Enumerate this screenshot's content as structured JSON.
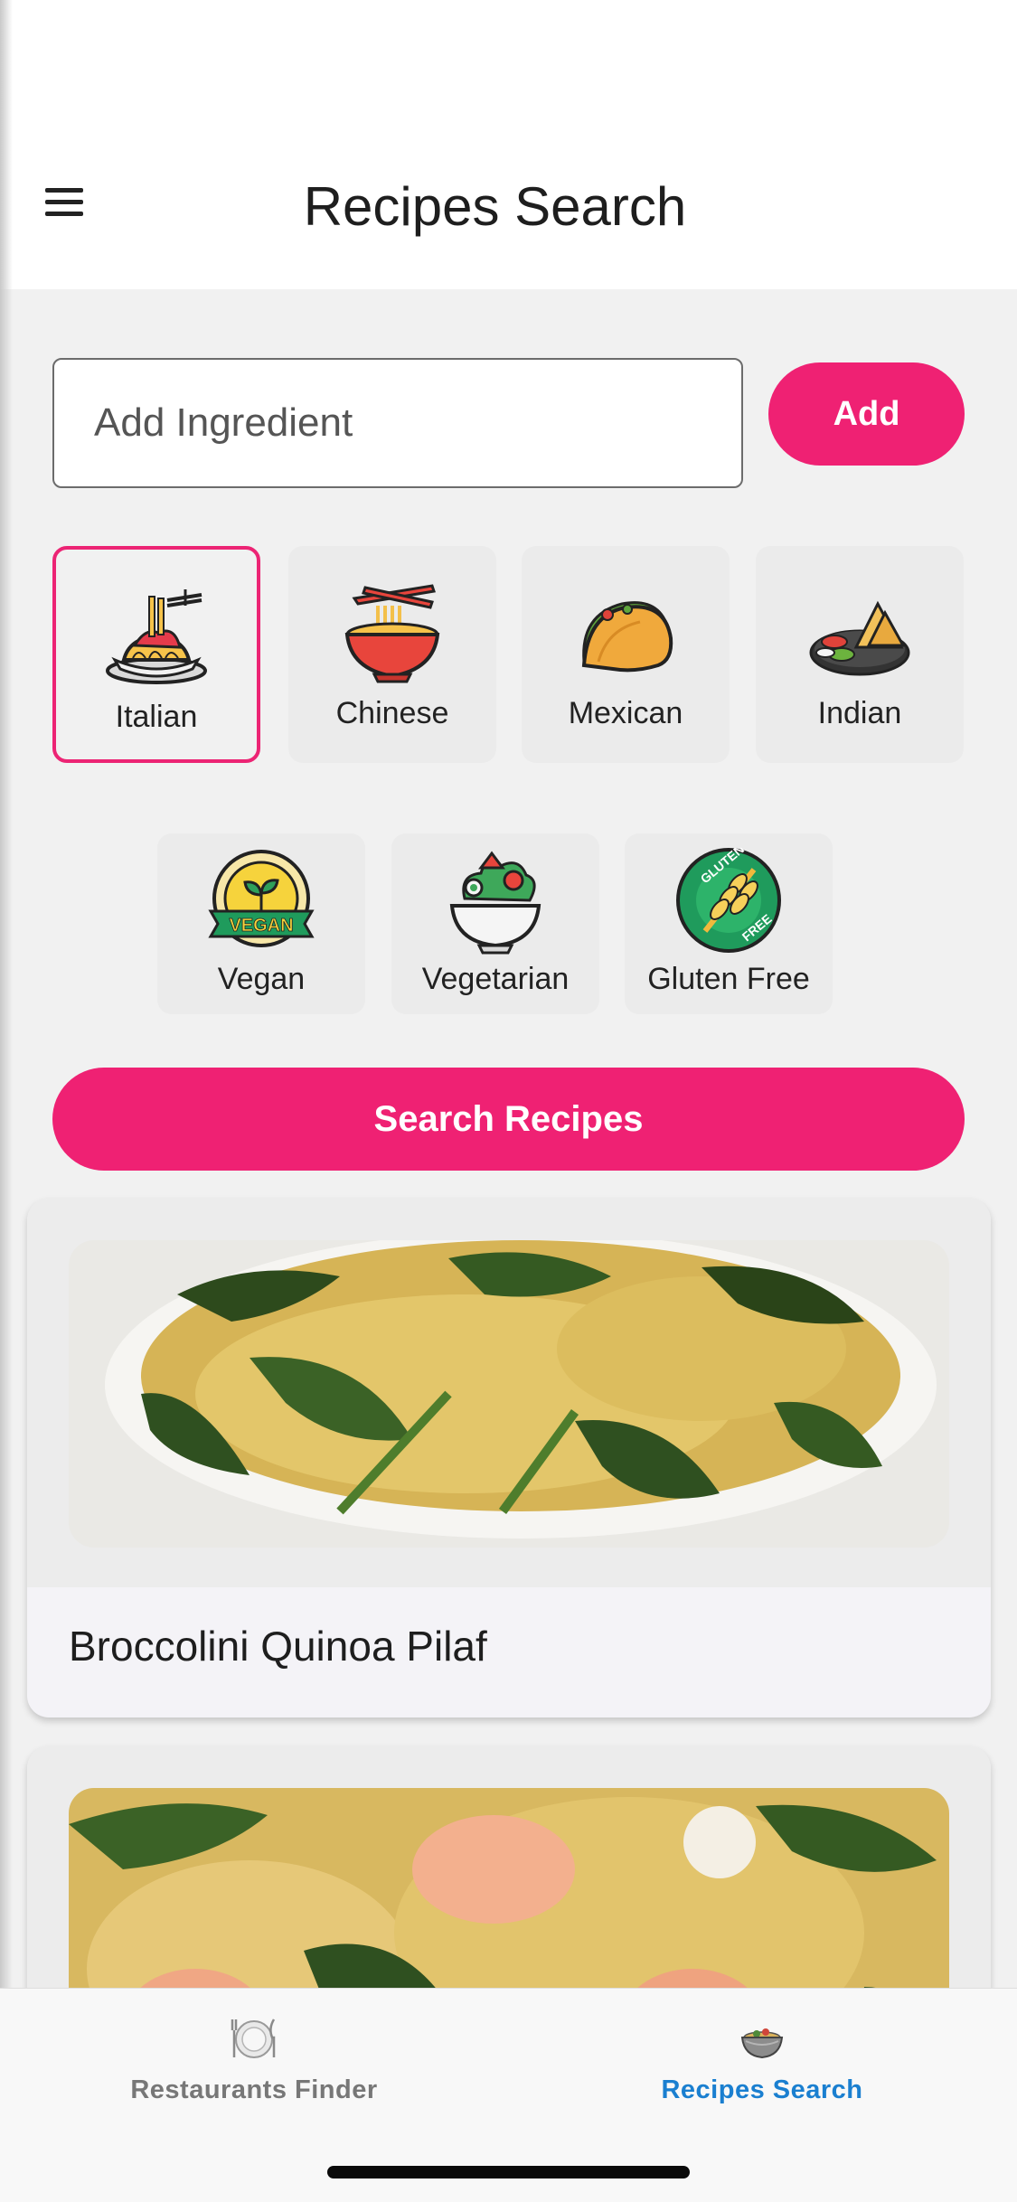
{
  "header": {
    "title": "Recipes Search",
    "menu_icon": "hamburger-menu-icon"
  },
  "ingredient": {
    "placeholder": "Add Ingredient",
    "value": "",
    "add_label": "Add"
  },
  "cuisines": [
    {
      "label": "Italian",
      "icon": "spaghetti-icon",
      "selected": true
    },
    {
      "label": "Chinese",
      "icon": "noodle-bowl-icon",
      "selected": false
    },
    {
      "label": "Mexican",
      "icon": "taco-icon",
      "selected": false
    },
    {
      "label": "Indian",
      "icon": "samosa-icon",
      "selected": false
    },
    {
      "label": "Vegan",
      "icon": "vegan-badge-icon",
      "selected": false
    },
    {
      "label": "Vegetarian",
      "icon": "salad-bowl-icon",
      "selected": false
    },
    {
      "label": "Gluten Free",
      "icon": "gluten-free-badge-icon",
      "selected": false
    }
  ],
  "search_label": "Search Recipes",
  "recipes": [
    {
      "title": "Broccolini Quinoa Pilaf"
    },
    {
      "title": ""
    }
  ],
  "bottom_nav": [
    {
      "label": "Restaurants Finder",
      "icon": "plate-cutlery-icon",
      "active": false
    },
    {
      "label": "Recipes Search",
      "icon": "food-bowl-icon",
      "active": true
    }
  ],
  "colors": {
    "accent": "#ef2173",
    "nav_active": "#1a7fd0",
    "nav_inactive": "#777777"
  }
}
